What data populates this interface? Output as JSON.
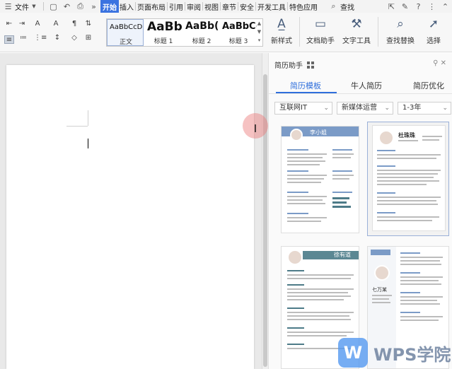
{
  "menubar": {
    "file_label": "文件",
    "tabs": [
      "开始",
      "插入",
      "页面布局",
      "引用",
      "审阅",
      "视图",
      "章节",
      "安全",
      "开发工具",
      "特色应用"
    ],
    "active_tab": "开始",
    "search_label": "查找",
    "more_glyph": "»"
  },
  "ribbon": {
    "styles": [
      {
        "sample": "AaBbCcDd",
        "caption": "正文"
      },
      {
        "sample": "AaBb",
        "caption": "标题 1"
      },
      {
        "sample": "AaBb(",
        "caption": "标题 2"
      },
      {
        "sample": "AaBbC(",
        "caption": "标题 3"
      }
    ],
    "new_style_label": "新样式",
    "writer_helper_label": "文档助手",
    "text_tools_label": "文字工具",
    "find_replace_label": "查找替换",
    "select_label": "选择"
  },
  "panel": {
    "title": "简历助手",
    "tabs": [
      "简历模板",
      "牛人简历",
      "简历优化"
    ],
    "active_tab_index": 0,
    "filters": [
      {
        "value": "互联网IT"
      },
      {
        "value": "新媒体运营"
      },
      {
        "value": "1-3年"
      }
    ],
    "templates": [
      {
        "name": "李小姐",
        "style": "blue-header"
      },
      {
        "name": "杜珠珠",
        "style": "plain-photo"
      },
      {
        "name": "徐有道",
        "style": "teal-band"
      },
      {
        "name": "七万某",
        "style": "sidebar"
      }
    ]
  },
  "watermark": {
    "logo_letter": "W",
    "text": "WPS学院"
  },
  "colors": {
    "accent": "#2f6fdc",
    "active_tab_bg": "#3b73e0",
    "cursor_halo": "#ec7878"
  },
  "icons": [
    "menu-icon",
    "save-icon",
    "undo-icon",
    "print-icon",
    "search-icon",
    "share-icon",
    "help-icon",
    "more-icon",
    "minimize-icon",
    "close-icon",
    "grid-icon"
  ]
}
